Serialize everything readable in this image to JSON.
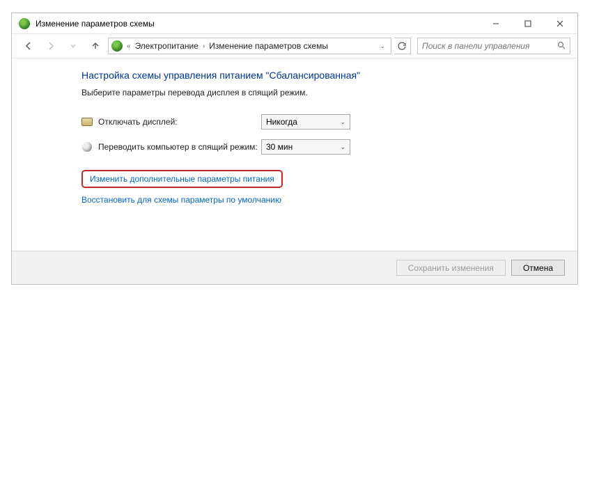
{
  "titlebar": {
    "title": "Изменение параметров схемы"
  },
  "breadcrumb": {
    "parent": "Электропитание",
    "current": "Изменение параметров схемы"
  },
  "search": {
    "placeholder": "Поиск в панели управления"
  },
  "page": {
    "heading": "Настройка схемы управления питанием \"Сбалансированная\"",
    "subtitle": "Выберите параметры перевода дисплея в спящий режим."
  },
  "settings": {
    "display_off_label": "Отключать дисплей:",
    "display_off_value": "Никогда",
    "sleep_label": "Переводить компьютер в спящий режим:",
    "sleep_value": "30 мин"
  },
  "links": {
    "advanced": "Изменить дополнительные параметры питания",
    "restore": "Восстановить для схемы параметры по умолчанию"
  },
  "buttons": {
    "save": "Сохранить изменения",
    "cancel": "Отмена"
  }
}
